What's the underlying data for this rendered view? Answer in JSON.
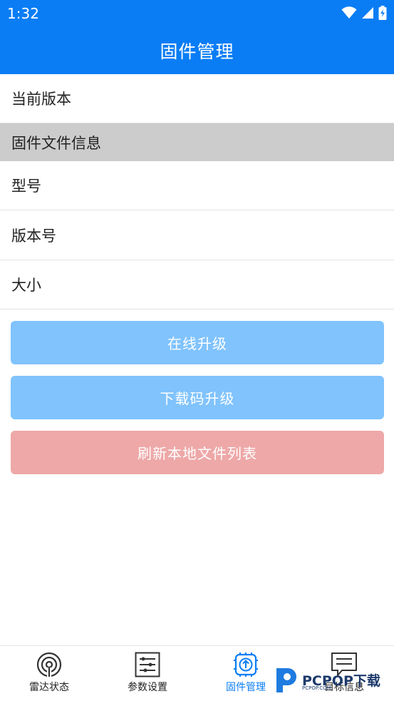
{
  "status_bar": {
    "time": "1:32",
    "icons": [
      "wifi-icon",
      "signal-icon",
      "battery-charging-icon"
    ]
  },
  "app_bar": {
    "title": "固件管理"
  },
  "rows": {
    "current_version": "当前版本",
    "section_firmware_info": "固件文件信息",
    "model": "型号",
    "version_number": "版本号",
    "size": "大小"
  },
  "buttons": {
    "online_upgrade": "在线升级",
    "download_code_upgrade": "下载码升级",
    "refresh_local_files": "刷新本地文件列表"
  },
  "bottom_nav": {
    "items": [
      {
        "label": "雷达状态",
        "icon": "radar-icon"
      },
      {
        "label": "参数设置",
        "icon": "sliders-icon"
      },
      {
        "label": "固件管理",
        "icon": "firmware-upload-icon",
        "active": true
      },
      {
        "label": "目标信息",
        "icon": "message-icon"
      }
    ]
  },
  "watermark": {
    "text": "PCPOP下载",
    "small": "PCPOP.COM"
  },
  "colors": {
    "primary": "#0a7df5",
    "button_blue": "#80c3fd",
    "button_red": "#eea8a8",
    "section_bg": "#cccccc"
  }
}
